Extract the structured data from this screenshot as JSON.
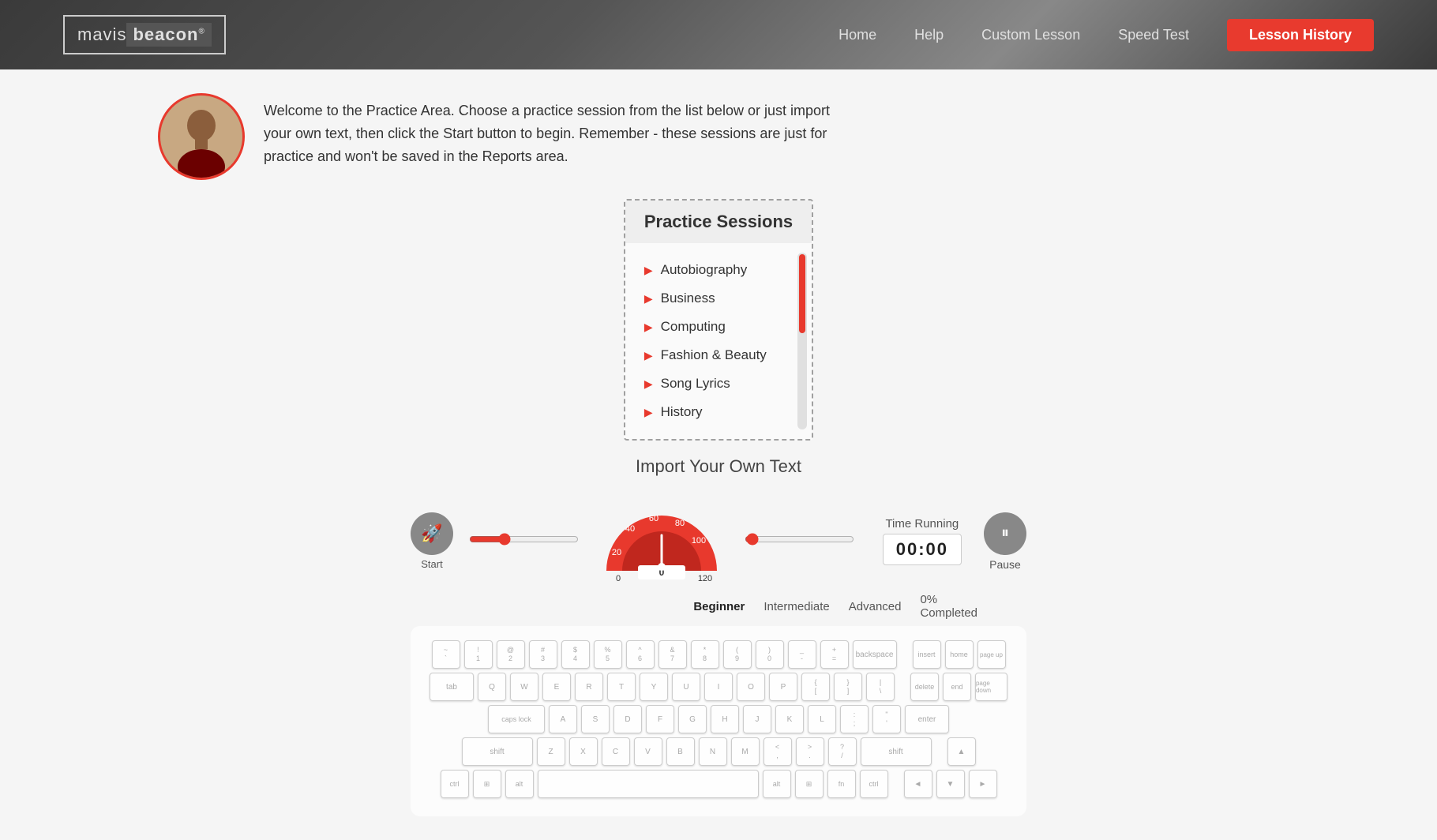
{
  "header": {
    "logo_mavis": "mavis",
    "logo_beacon": "beacon",
    "logo_tm": "®",
    "nav": {
      "home": "Home",
      "help": "Help",
      "custom_lesson": "Custom Lesson",
      "speed_test": "Speed Test",
      "lesson_history": "Lesson History"
    }
  },
  "welcome": {
    "text": "Welcome to the Practice Area. Choose a practice session from the list below or just import your own text, then click the Start button to begin. Remember - these sessions are just for practice and won't be saved in the Reports area."
  },
  "practice": {
    "title": "Practice Sessions",
    "items": [
      "Autobiography",
      "Business",
      "Computing",
      "Fashion & Beauty",
      "Song Lyrics",
      "History"
    ]
  },
  "import": {
    "label": "Import Your Own Text"
  },
  "speed": {
    "time_running_label": "Time Running",
    "time_value": "00:00",
    "pause_label": "Pause",
    "start_label": "Start",
    "levels": [
      "Beginner",
      "Intermediate",
      "Advanced"
    ],
    "active_level": "Beginner",
    "completed": "0% Completed",
    "gauge": {
      "labels": [
        "40",
        "60",
        "80",
        "20",
        "100"
      ],
      "bottom_labels": [
        "0",
        "0",
        "120"
      ],
      "needle_value": 0
    }
  },
  "keyboard": {
    "rows": [
      [
        "~`",
        "1!",
        "2@",
        "3#",
        "4$",
        "5%",
        "6^",
        "7&",
        "8*",
        "9(",
        "0)",
        "-_",
        "=+",
        "backspace"
      ],
      [
        "tab",
        "Q",
        "W",
        "E",
        "R",
        "T",
        "Y",
        "U",
        "I",
        "O",
        "P",
        "[{",
        "]}",
        "\\|"
      ],
      [
        "caps lock",
        "A",
        "S",
        "D",
        "F",
        "G",
        "H",
        "J",
        "K",
        "L",
        ";:",
        "'\"",
        "enter"
      ],
      [
        "shift",
        "Z",
        "X",
        "C",
        "V",
        "B",
        "N",
        "M",
        ",<",
        ".>",
        "/?",
        "shift"
      ],
      [
        "ctrl",
        "win",
        "alt",
        "",
        "alt",
        "win",
        "fn",
        "ctrl"
      ]
    ],
    "numpad": [
      "insert",
      "home",
      "pg up",
      "delete",
      "end",
      "pg dn"
    ]
  }
}
